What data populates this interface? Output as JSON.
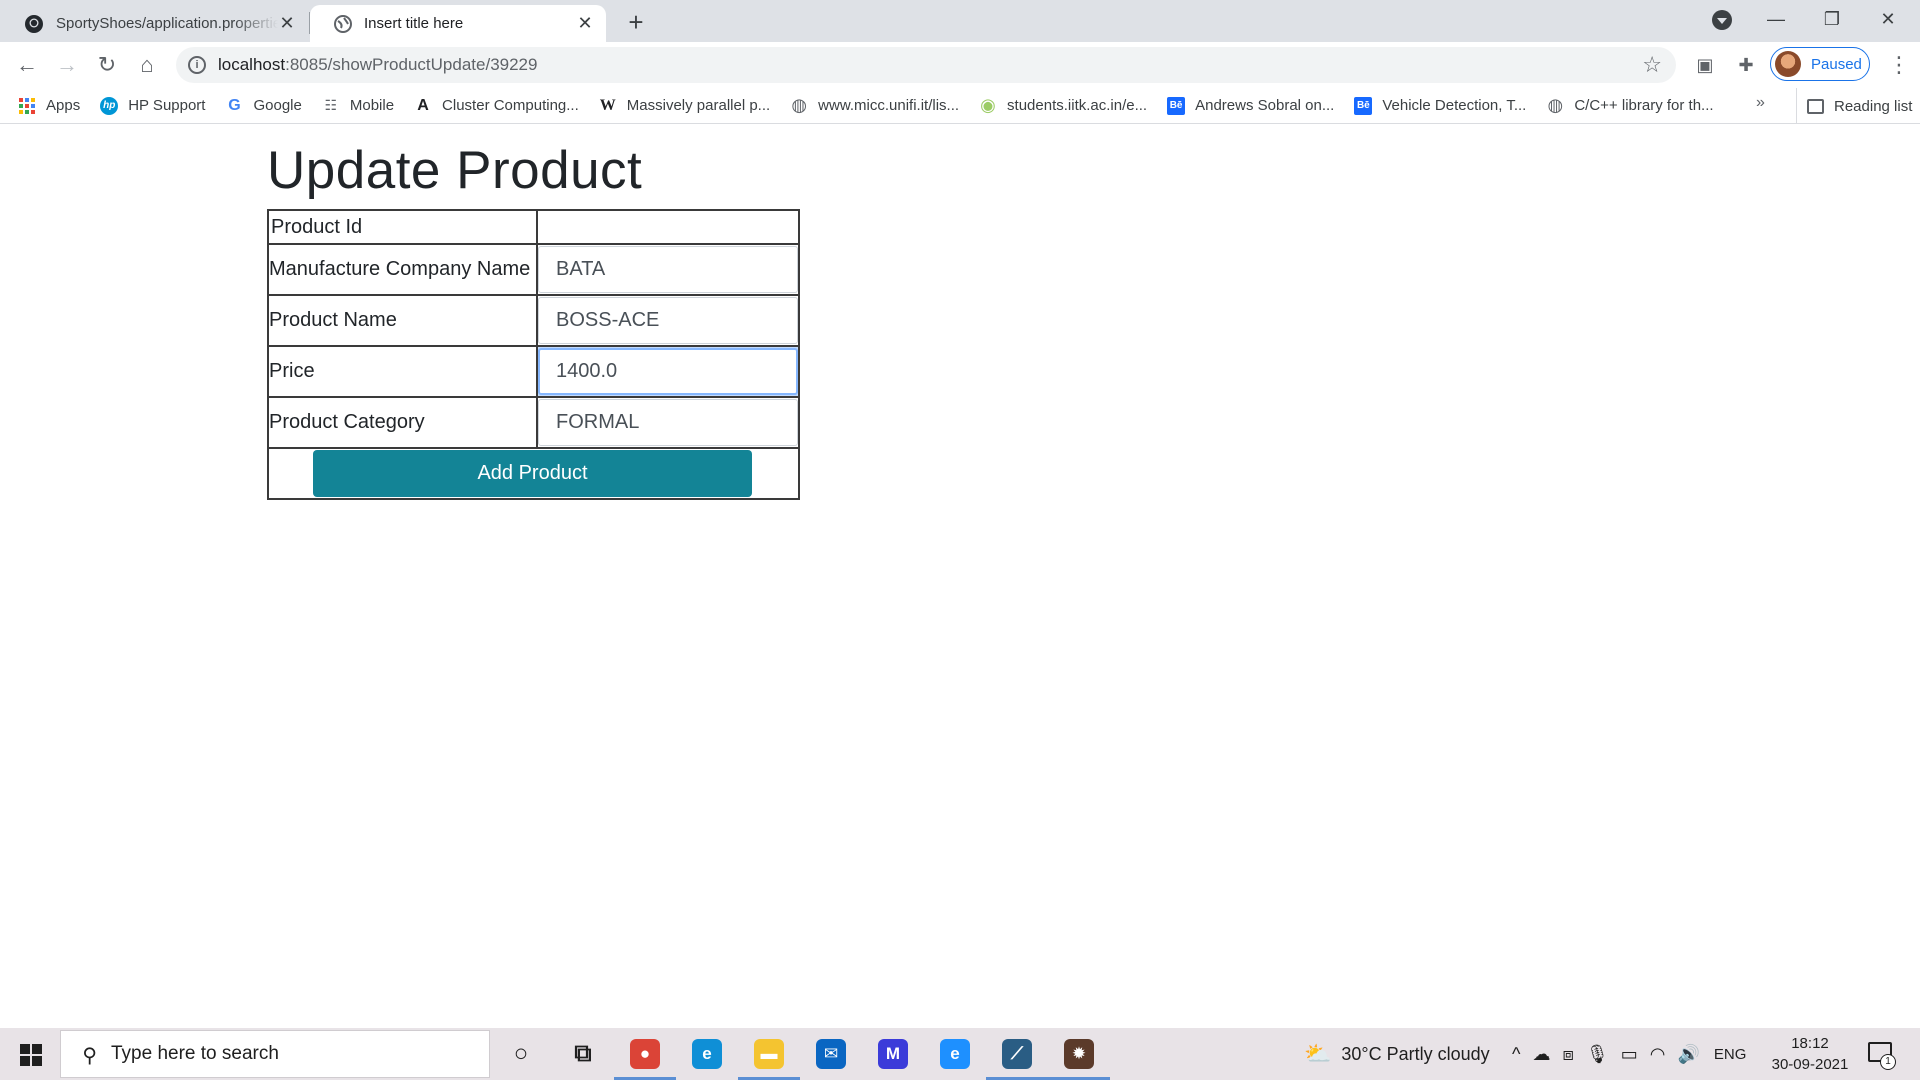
{
  "browser": {
    "tabs": [
      {
        "title": "SportyShoes/application.properties",
        "icon": "github-icon",
        "active": false
      },
      {
        "title": "Insert title here",
        "icon": "globe-icon",
        "active": true
      }
    ],
    "address": {
      "host": "localhost",
      "path": ":8085/showProductUpdate/39229"
    },
    "profile_label": "Paused",
    "bookmarks": [
      {
        "label": "Apps",
        "icon": "apps-grid-icon"
      },
      {
        "label": "HP Support",
        "icon": "hp-icon",
        "glyph": "hp",
        "color": "#0096d6"
      },
      {
        "label": "Google",
        "icon": "google-icon",
        "glyph": "G",
        "color": "#4285f4"
      },
      {
        "label": "Mobile",
        "icon": "mobile-icon",
        "glyph": "☷",
        "color": "#5f6368"
      },
      {
        "label": "Cluster Computing...",
        "icon": "font-a-icon",
        "glyph": "A",
        "color": "#202124"
      },
      {
        "label": "Massively parallel p...",
        "icon": "wikipedia-icon",
        "glyph": "W",
        "color": "#202124"
      },
      {
        "label": "www.micc.unifi.it/lis...",
        "icon": "globe-icon",
        "glyph": "◍",
        "color": "#5f6368"
      },
      {
        "label": "students.iitk.ac.in/e...",
        "icon": "iitk-icon",
        "glyph": "◉",
        "color": "#9ccc65"
      },
      {
        "label": "Andrews Sobral on...",
        "icon": "behance-icon",
        "glyph": "Bē",
        "color": "#1769ff"
      },
      {
        "label": "Vehicle Detection, T...",
        "icon": "behance-icon",
        "glyph": "Bē",
        "color": "#1769ff"
      },
      {
        "label": "C/C++ library for th...",
        "icon": "globe-icon",
        "glyph": "◍",
        "color": "#5f6368"
      }
    ],
    "bookmarks_more": "»",
    "reading_list": "Reading list"
  },
  "page": {
    "title": "Update Product",
    "fields": [
      {
        "label": "Product Id",
        "value": ""
      },
      {
        "label": "Manufacture Company Name",
        "value": "BATA"
      },
      {
        "label": "Product Name",
        "value": "BOSS-ACE"
      },
      {
        "label": "Price",
        "value": "1400.0",
        "focused": true
      },
      {
        "label": "Product Category",
        "value": "FORMAL"
      }
    ],
    "submit_label": "Add Product",
    "submit_color": "#138496"
  },
  "taskbar": {
    "search_placeholder": "Type here to search",
    "weather": "30°C  Partly cloudy",
    "language": "ENG",
    "time": "18:12",
    "date": "30-09-2021",
    "notification_count": "1",
    "apps": [
      {
        "name": "cortana-icon",
        "glyph": "○",
        "color": "#1f1f1f",
        "bg": "transparent",
        "active": false
      },
      {
        "name": "task-view-icon",
        "glyph": "⧉",
        "color": "#1f1f1f",
        "bg": "transparent",
        "active": false
      },
      {
        "name": "chrome-icon",
        "glyph": "●",
        "color": "#ffffff",
        "bg": "#db4437",
        "active": true
      },
      {
        "name": "edge-icon",
        "glyph": "e",
        "color": "#ffffff",
        "bg": "#0f8fd6",
        "active": false
      },
      {
        "name": "file-explorer-icon",
        "glyph": "▬",
        "color": "#ffffff",
        "bg": "#f4c430",
        "active": true
      },
      {
        "name": "mail-icon",
        "glyph": "✉",
        "color": "#ffffff",
        "bg": "#0a66c2",
        "active": false
      },
      {
        "name": "mathworks-icon",
        "glyph": "M",
        "color": "#ffffff",
        "bg": "#3b3bd9",
        "active": false
      },
      {
        "name": "internet-explorer-icon",
        "glyph": "e",
        "color": "#ffffff",
        "bg": "#1e90ff",
        "active": false
      },
      {
        "name": "spring-tool-icon",
        "glyph": "⟋",
        "color": "#ffffff",
        "bg": "#2a5d84",
        "active": true
      },
      {
        "name": "app-badge-icon",
        "glyph": "✹",
        "color": "#ffffff",
        "bg": "#5b3a2a",
        "active": true
      }
    ]
  }
}
